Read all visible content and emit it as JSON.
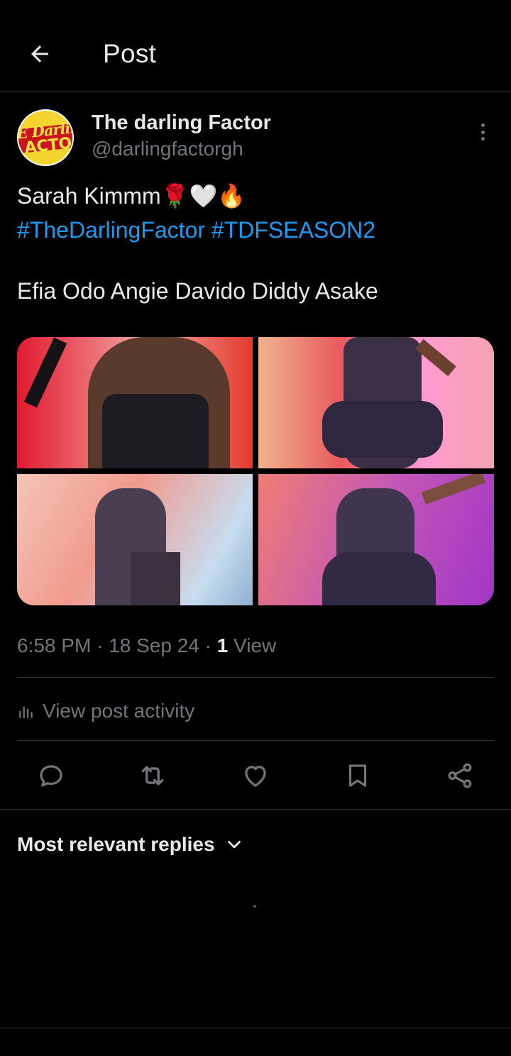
{
  "header": {
    "title": "Post"
  },
  "author": {
    "display_name": "The darling Factor",
    "handle": "@darlingfactorgh",
    "avatar_text_top": "E Darlin",
    "avatar_text_bottom": "ACTO"
  },
  "tweet": {
    "text_plain": "Sarah Kimmm",
    "emojis": "🌹🤍🔥",
    "hashtag_1": "#TheDarlingFactor",
    "hashtag_2": "#TDFSEASON2",
    "line_3": "Efia Odo Angie Davido Diddy Asake",
    "photo_count": 4
  },
  "meta": {
    "time": "6:58 PM",
    "date": "18 Sep 24",
    "views_count": "1",
    "views_label": "View"
  },
  "activity": {
    "label": "View post activity"
  },
  "actions": [
    "reply",
    "repost",
    "like",
    "bookmark",
    "share"
  ],
  "replies": {
    "sort_label": "Most relevant replies"
  },
  "colors": {
    "background": "#000000",
    "text": "#e7e9ea",
    "secondary": "#71767b",
    "accent": "#1d9bf0",
    "divider": "#2f3336"
  }
}
